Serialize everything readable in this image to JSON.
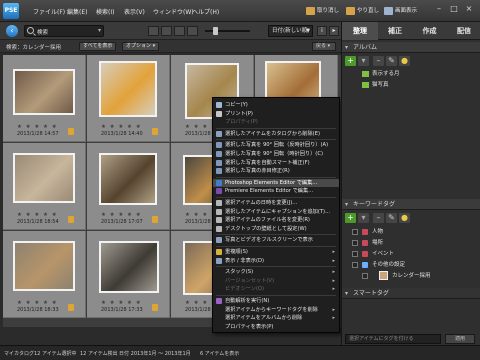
{
  "app": {
    "logo_text": "PSE"
  },
  "menubar": {
    "items": [
      {
        "label": "ファイル(F)"
      },
      {
        "label": "編集(E)"
      },
      {
        "label": "検索(I)"
      },
      {
        "label": "表示(V)"
      },
      {
        "label": "ウィンドウ(W)"
      },
      {
        "label": "ヘルプ(H)"
      }
    ]
  },
  "title_buttons": {
    "undo": "取り消し",
    "redo": "やり直し",
    "display": "画面表示"
  },
  "toolbar": {
    "search_value": "検索",
    "sort_value": "日付(新しい順)"
  },
  "filterbar": {
    "label": "検索：カレンダー採用",
    "show_all": "すべてを表示",
    "options": "オプション",
    "right_menu": "戻る"
  },
  "grid": {
    "stars": "★ ★ ★ ★ ★",
    "items": [
      {
        "date": "2013/1/28 14:57",
        "thumb_color": "#6f5a48",
        "accent": "#b39b7a"
      },
      {
        "date": "2013/1/28 14:40",
        "thumb_color": "#d7cdbb",
        "accent": "#e2a23a"
      },
      {
        "date": "2013/1/28 14:40",
        "thumb_color": "#c6b7a0",
        "accent": "#a5864c"
      },
      {
        "date": "2013/1/28 14:40",
        "thumb_color": "#d8c08f",
        "accent": "#a36d36"
      },
      {
        "date": "2013/1/28 18:54",
        "thumb_color": "#9a8a74",
        "accent": "#c7b69c"
      },
      {
        "date": "2013/1/28 17:07",
        "thumb_color": "#b0a084",
        "accent": "#55432f"
      },
      {
        "date": "2013/1/28 17:07",
        "thumb_color": "#4c463e",
        "accent": "#c08f4a"
      },
      {
        "date": "",
        "thumb_color": "#6a6a6a",
        "accent": "#888"
      },
      {
        "date": "2013/1/28 18:33",
        "thumb_color": "#8e826f",
        "accent": "#b7956a"
      },
      {
        "date": "2013/1/28 17:33",
        "thumb_color": "#9f9a90",
        "accent": "#3e3a34"
      },
      {
        "date": "2013/1/28 17:37",
        "thumb_color": "#7b6a55",
        "accent": "#d0a468"
      },
      {
        "date": "",
        "thumb_color": "#6a6a6a",
        "accent": "#888"
      }
    ]
  },
  "context_menu": {
    "items": [
      {
        "label": "コピー(Y)",
        "icon_color": "#9fb6d4",
        "disabled": false,
        "sub": false
      },
      {
        "label": "プリント(P)",
        "icon_color": "#c7c7c7",
        "disabled": false,
        "sub": false
      },
      {
        "label": "プロパティ(P)",
        "icon_color": "",
        "disabled": true,
        "sub": false
      },
      {
        "label": "選択したアイテムをカタログから削除(E)",
        "icon_color": "#8aa0c0",
        "disabled": false,
        "sub": false
      },
      {
        "label": "選択した写真を 90° 回転（反時計回り）(A)",
        "icon_color": "#7e97bb",
        "disabled": false,
        "sub": false
      },
      {
        "label": "選択した写真を 90° 回転（時計回り）(C)",
        "icon_color": "#7e97bb",
        "disabled": false,
        "sub": false
      },
      {
        "label": "選択した写真を自動スマート補正(F)",
        "icon_color": "#7e97bb",
        "disabled": false,
        "sub": false
      },
      {
        "label": "選択した写真の赤目修正(R)",
        "icon_color": "#7e97bb",
        "disabled": false,
        "sub": false
      },
      {
        "label": "Photoshop Elements Editor で編集...",
        "icon_color": "#3d7fc9",
        "disabled": false,
        "sub": false
      },
      {
        "label": "Premiere Elements Editor で編集...",
        "icon_color": "#7a4bb3",
        "disabled": false,
        "sub": false
      },
      {
        "label": "選択アイテムの日時を変更(J)...",
        "icon_color": "#b6b6b6",
        "disabled": false,
        "sub": false
      },
      {
        "label": "選択したアイテムにキャプションを追加(T)...",
        "icon_color": "#b6b6b6",
        "disabled": false,
        "sub": false
      },
      {
        "label": "選択アイテムのファイル名を変更(R)",
        "icon_color": "#b6b6b6",
        "disabled": false,
        "sub": false
      },
      {
        "label": "デスクトップの壁紙として設定(W)",
        "icon_color": "#b6b6b6",
        "disabled": false,
        "sub": false
      },
      {
        "label": "写真とビデオをフルスクリーンで表示",
        "icon_color": "#8aa0c0",
        "disabled": false,
        "sub": false
      },
      {
        "label": "重複順(S)",
        "icon_color": "#d6b23a",
        "disabled": false,
        "sub": true
      },
      {
        "label": "表示 / 非表示(D)",
        "icon_color": "#8aa0c0",
        "disabled": false,
        "sub": true
      },
      {
        "label": "スタック(S)",
        "icon_color": "",
        "disabled": false,
        "sub": true
      },
      {
        "label": "バージョンセット(V)",
        "icon_color": "",
        "disabled": true,
        "sub": true
      },
      {
        "label": "ビデオシーン(Q)",
        "icon_color": "",
        "disabled": true,
        "sub": true
      },
      {
        "label": "自動解析を実行(N)",
        "icon_color": "#9a62c8",
        "disabled": false,
        "sub": false
      },
      {
        "label": "選択アイテムからキーワードタグを削除",
        "icon_color": "",
        "disabled": false,
        "sub": true
      },
      {
        "label": "選択アイテムをアルバムから削除",
        "icon_color": "",
        "disabled": false,
        "sub": true
      },
      {
        "label": "プロパティを表示(P)",
        "icon_color": "",
        "disabled": false,
        "sub": false
      }
    ]
  },
  "right_panel": {
    "tabs": [
      "整理",
      "補正",
      "作成",
      "配信"
    ],
    "albums_header": "アルバム",
    "albums": [
      {
        "label": "表示する月"
      },
      {
        "label": "猫写真"
      }
    ],
    "keywords_header": "キーワードタグ",
    "keywords": [
      {
        "label": "人物",
        "icon_color": "#c84a5a"
      },
      {
        "label": "場所",
        "icon_color": "#c84a5a"
      },
      {
        "label": "イベント",
        "icon_color": "#c84a5a"
      },
      {
        "label": "その他の設定",
        "icon_color": "#6bb0ff"
      },
      {
        "label": "カレンダー採用",
        "icon_color": ""
      }
    ],
    "smart_tags_label": "スマートタグ",
    "keyword_search_placeholder": "選択アイテムにタグを付ける",
    "apply_label": "適用"
  },
  "statusbar": {
    "catalog": "マイカタログ",
    "selection": "12 アイテム選択中",
    "range": "12 アイテム検出 日付 2013年1月 ～ 2013年1月",
    "count": "6 アイテムを表示"
  }
}
